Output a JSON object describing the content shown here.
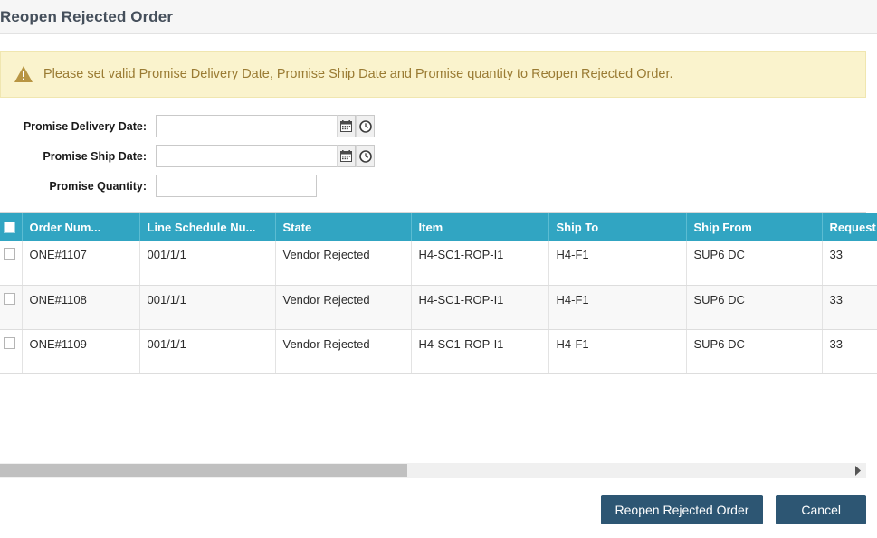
{
  "dialog": {
    "title": "Reopen Rejected Order"
  },
  "warning": {
    "icon": "warning-triangle-icon",
    "message": "Please set valid Promise Delivery Date, Promise Ship Date and Promise quantity to Reopen Rejected Order."
  },
  "form": {
    "fields": [
      {
        "label": "Promise Delivery Date:",
        "value": "",
        "placeholder": "",
        "icons": [
          "calendar-icon",
          "clock-icon"
        ]
      },
      {
        "label": "Promise Ship Date:",
        "value": "",
        "placeholder": "",
        "icons": [
          "calendar-icon",
          "clock-icon"
        ]
      },
      {
        "label": "Promise Quantity:",
        "value": "",
        "placeholder": "",
        "icons": []
      }
    ]
  },
  "table": {
    "columns": [
      "Order Num...",
      "Line Schedule Nu...",
      "State",
      "Item",
      "Ship To",
      "Ship From",
      "Request Quan"
    ],
    "rows": [
      {
        "order_number": "ONE#1107",
        "line_schedule_number": "001/1/1",
        "state": "Vendor Rejected",
        "item": "H4-SC1-ROP-I1",
        "ship_to": "H4-F1",
        "ship_from": "SUP6 DC",
        "request_quantity": "33"
      },
      {
        "order_number": "ONE#1108",
        "line_schedule_number": "001/1/1",
        "state": "Vendor Rejected",
        "item": "H4-SC1-ROP-I1",
        "ship_to": "H4-F1",
        "ship_from": "SUP6 DC",
        "request_quantity": "33"
      },
      {
        "order_number": "ONE#1109",
        "line_schedule_number": "001/1/1",
        "state": "Vendor Rejected",
        "item": "H4-SC1-ROP-I1",
        "ship_to": "H4-F1",
        "ship_from": "SUP6 DC",
        "request_quantity": "33"
      }
    ]
  },
  "scrollbar": {
    "orientation": "horizontal",
    "thumb_fraction_percent": 47,
    "right_arrow_icon": "triangle-right-icon"
  },
  "footer": {
    "submit_label": "Reopen Rejected Order",
    "cancel_label": "Cancel"
  },
  "colors": {
    "table_header": "#31a5c2",
    "warning_background": "#faf3cd",
    "warning_text": "#9a7b33",
    "button": "#2d5673",
    "title_text": "#454f5b"
  }
}
